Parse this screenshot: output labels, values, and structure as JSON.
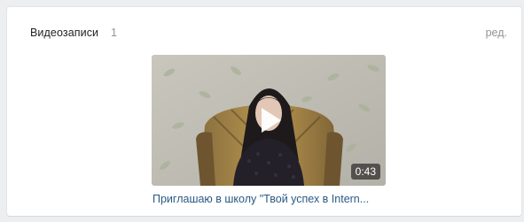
{
  "section": {
    "title": "Видеозаписи",
    "count": "1",
    "edit_label": "ред."
  },
  "video": {
    "duration": "0:43",
    "caption": "Приглашаю в школу \"Твой успех в Intern..."
  },
  "icons": {
    "play": "play-icon"
  }
}
